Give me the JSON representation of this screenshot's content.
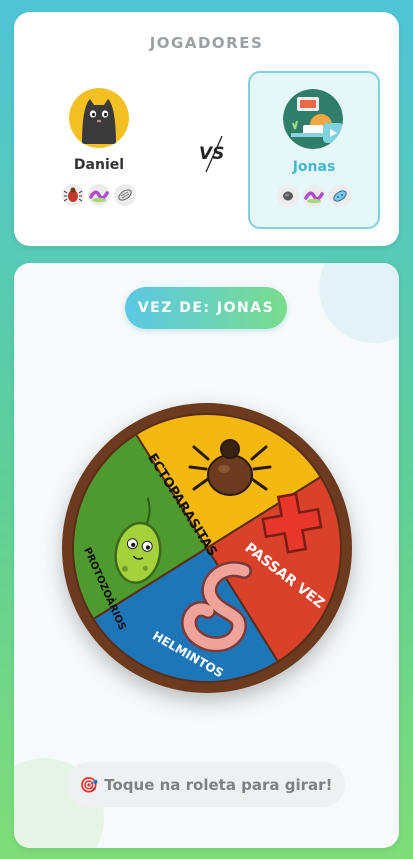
{
  "players_section": {
    "title": "JOGADORES",
    "vs_label": "VS",
    "players": [
      {
        "name": "Daniel",
        "avatar": "black-cat-avatar",
        "collected": [
          "tick-icon",
          "worm-icon",
          "protozoa-icon"
        ],
        "active": false
      },
      {
        "name": "Jonas",
        "avatar": "scientist-avatar",
        "collected": [
          "stone-icon",
          "worm-icon",
          "protozoa-icon"
        ],
        "active": true
      }
    ]
  },
  "game": {
    "turn_label": "VEZ DE: JONAS",
    "wheel": {
      "segments": [
        {
          "label": "ECTOPARASITAS",
          "color": "#f5b80f",
          "icon": "tick-icon"
        },
        {
          "label": "PASSAR VEZ",
          "color": "#d9412b",
          "icon": "cross-icon"
        },
        {
          "label": "HELMINTOS",
          "color": "#1c76b8",
          "icon": "worm-icon"
        },
        {
          "label": "PROTOZOÁRIOS",
          "color": "#4f9a2f",
          "icon": "protozoa-icon"
        }
      ],
      "rim_color": "#6b3a1f"
    },
    "hint_icon": "🎯",
    "hint_text": "Toque na roleta para girar!"
  }
}
